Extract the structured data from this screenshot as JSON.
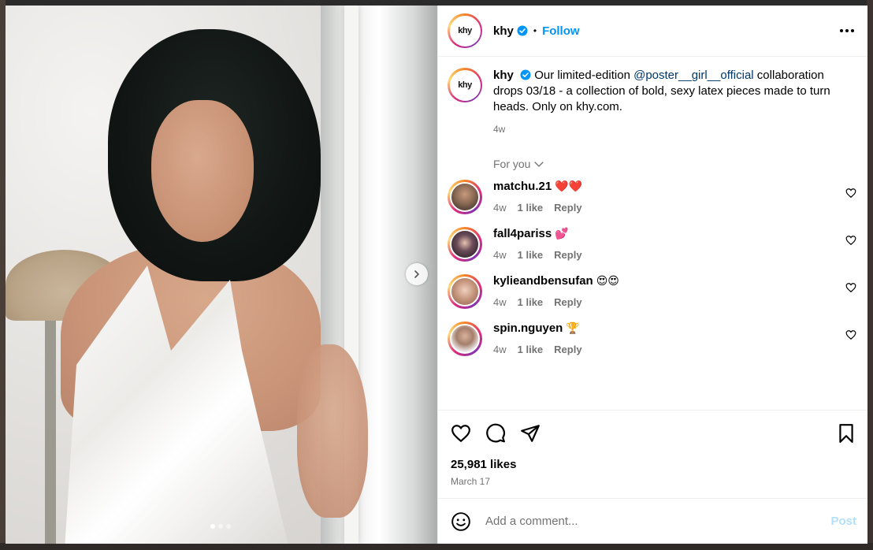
{
  "account": {
    "logo_text": "khy",
    "username": "khy",
    "follow_label": "Follow",
    "separator": "•"
  },
  "caption": {
    "username": "khy",
    "text_before": "Our limited-edition ",
    "mention": "@poster__girl__official",
    "text_after": " collaboration drops 03/18 - a collection of bold, sexy latex pieces made to turn heads. Only on khy.com.",
    "age": "4w"
  },
  "comments_filter": "For you",
  "comments": [
    {
      "username": "matchu.21",
      "text": "❤️❤️",
      "age": "4w",
      "likes": "1 like",
      "reply": "Reply"
    },
    {
      "username": "fall4pariss",
      "text": "💕",
      "age": "4w",
      "likes": "1 like",
      "reply": "Reply"
    },
    {
      "username": "kylieandbensufan",
      "text": "😍😍",
      "age": "4w",
      "likes": "1 like",
      "reply": "Reply"
    },
    {
      "username": "spin.nguyen",
      "text": "🏆",
      "age": "4w",
      "likes": "1 like",
      "reply": "Reply"
    }
  ],
  "post": {
    "likes": "25,981 likes",
    "date": "March 17"
  },
  "add_comment": {
    "placeholder": "Add a comment...",
    "post_label": "Post"
  },
  "carousel": {
    "slide_count": 3,
    "active_slide": 1
  },
  "colors": {
    "accent": "#0095f6",
    "mention": "#00376b",
    "muted": "#737373",
    "post_disabled": "#b2dffc"
  }
}
